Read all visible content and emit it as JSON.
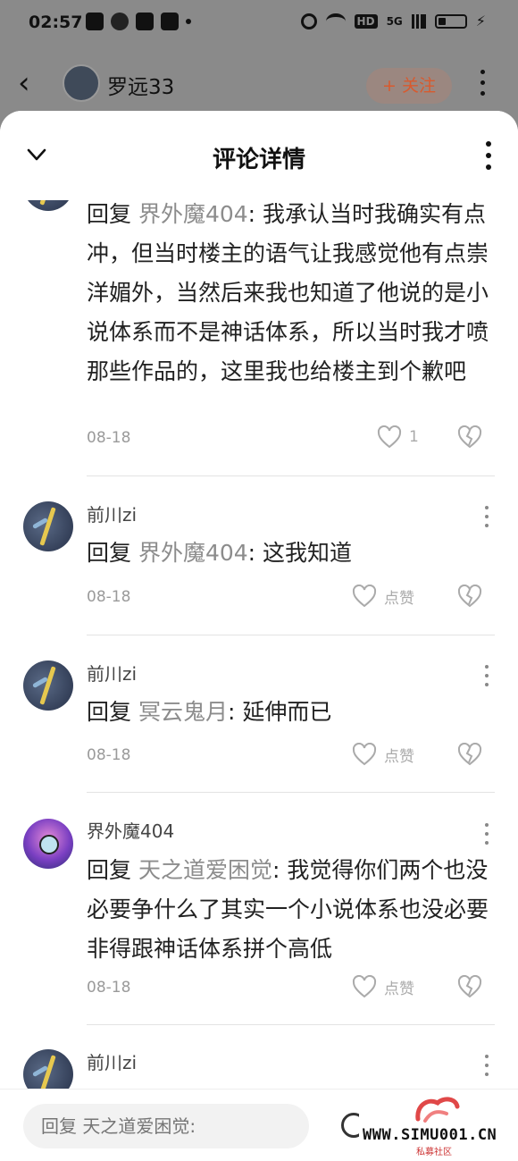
{
  "status_bar": {
    "time": "02:57",
    "network": "5G"
  },
  "background_header": {
    "back_icon": "chevron-left-icon",
    "username": "罗远33",
    "follow_label": "+ 关注"
  },
  "sheet": {
    "title": "评论详情"
  },
  "comments": [
    {
      "username": "",
      "reply_prefix": "回复 ",
      "reply_target": "界外魔404",
      "text": ": 我承认当时我确实有点冲，但当时楼主的语气让我感觉他有点崇洋媚外，当然后来我也知道了他说的是小说体系而不是神话体系，所以当时我才喷那些作品的，这里我也给楼主到个歉吧",
      "date": "08-18",
      "like_label": "1"
    },
    {
      "username": "前川zi",
      "reply_prefix": "回复 ",
      "reply_target": "界外魔404",
      "text": ": 这我知道",
      "date": "08-18",
      "like_label": "点赞"
    },
    {
      "username": "前川zi",
      "reply_prefix": "回复 ",
      "reply_target": "冥云鬼月",
      "text": ": 延伸而已",
      "date": "08-18",
      "like_label": "点赞"
    },
    {
      "username": "界外魔404",
      "reply_prefix": "回复 ",
      "reply_target": "天之道爱困觉",
      "text": ": 我觉得你们两个也没必要争什么了其实一个小说体系也没必要非得跟神话体系拼个高低",
      "date": "08-18",
      "like_label": "点赞"
    },
    {
      "username": "前川zi",
      "reply_prefix": "",
      "reply_target": "",
      "text": "",
      "date": "",
      "like_label": ""
    }
  ],
  "reply_bar": {
    "placeholder": "回复 天之道爱困觉:"
  },
  "watermark": {
    "text": "WWW.SIMU001.CN",
    "sub": "私募社区"
  },
  "colors": {
    "accent": "#e05a2b",
    "muted": "#9a9a9a",
    "reply_target": "#8c8c8c"
  }
}
